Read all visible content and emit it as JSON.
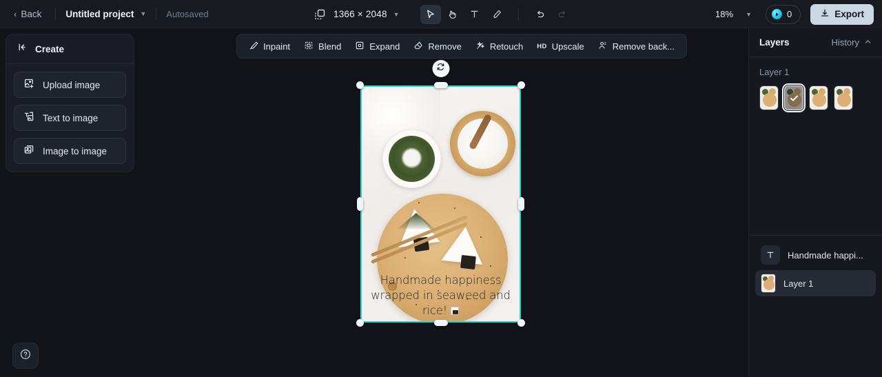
{
  "topbar": {
    "back_label": "Back",
    "project_name": "Untitled project",
    "autosaved_label": "Autosaved",
    "canvas_dimensions": "1366 × 2048",
    "zoom_level": "18%",
    "credits_count": "0",
    "export_label": "Export",
    "tools": [
      {
        "name": "select-tool",
        "icon": "cursor-arrow-icon",
        "active": true
      },
      {
        "name": "hand-tool",
        "icon": "hand-icon",
        "active": false
      },
      {
        "name": "text-tool",
        "icon": "text-t-icon",
        "active": false
      },
      {
        "name": "brush-tool",
        "icon": "brush-icon",
        "active": false
      },
      {
        "name": "undo",
        "icon": "undo-arrow-icon",
        "active": false
      },
      {
        "name": "redo",
        "icon": "redo-arrow-icon",
        "active": false
      }
    ]
  },
  "left_panel": {
    "title": "Create",
    "collapse_icon": "collapse-panel-icon",
    "items": [
      {
        "label": "Upload image",
        "icon": "upload-image-icon"
      },
      {
        "label": "Text to image",
        "icon": "text-to-image-icon"
      },
      {
        "label": "Image to image",
        "icon": "image-to-image-icon"
      }
    ],
    "help_icon": "question-mark-icon"
  },
  "edit_toolbar": {
    "items": [
      {
        "label": "Inpaint",
        "icon": "inpaint-brush-icon"
      },
      {
        "label": "Blend",
        "icon": "blend-icon"
      },
      {
        "label": "Expand",
        "icon": "expand-frame-icon"
      },
      {
        "label": "Remove",
        "icon": "eraser-icon"
      },
      {
        "label": "Retouch",
        "icon": "magic-wand-icon"
      },
      {
        "label": "Upscale",
        "icon": "hd-icon",
        "badge": "HD"
      },
      {
        "label": "Remove back...",
        "icon": "remove-background-icon"
      }
    ]
  },
  "canvas": {
    "selection_color": "#24d7d1",
    "rotate_icon": "rotate-icon",
    "artwork_caption": "Handmade happiness wrapped in seaweed and rice!",
    "artwork_caption_emoji": "rice-ball-emoji"
  },
  "right_panel": {
    "title": "Layers",
    "history_label": "History",
    "history_chevron_icon": "chevron-up-icon",
    "variations_group_name": "Layer 1",
    "variations": [
      {
        "name": "variation-1",
        "selected": false
      },
      {
        "name": "variation-2",
        "selected": true
      },
      {
        "name": "variation-3",
        "selected": false
      },
      {
        "name": "variation-4",
        "selected": false
      }
    ],
    "layers": [
      {
        "label": "Handmade happi...",
        "type": "text",
        "icon": "text-t-icon",
        "active": false
      },
      {
        "label": "Layer 1",
        "type": "image",
        "icon": "image-thumbnail",
        "active": true
      }
    ]
  }
}
